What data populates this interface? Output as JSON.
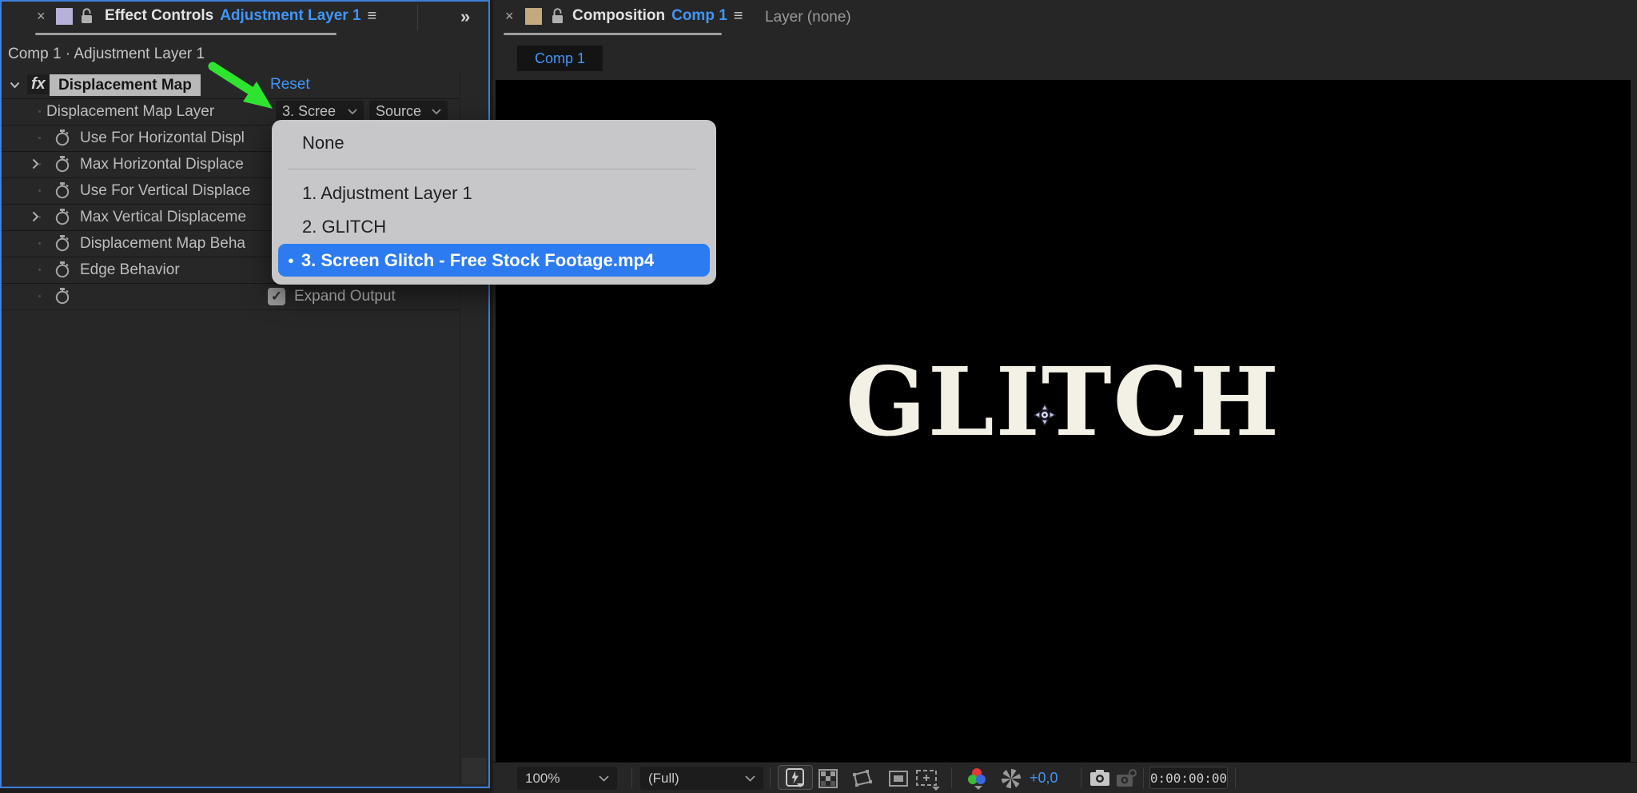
{
  "effect_panel": {
    "tab": {
      "close": "×",
      "title": "Effect Controls",
      "target": "Adjustment Layer 1",
      "menu_icon": "≡",
      "overflow_icon": "»"
    },
    "breadcrumb": "Comp 1 · Adjustment Layer 1",
    "effect_header": {
      "expand_icon": "∨",
      "fx_badge": "fx",
      "name": "Displacement Map",
      "reset": "Reset"
    },
    "rows": [
      {
        "label": "Displacement Map Layer",
        "value": "3. Scree",
        "channel": "Source"
      },
      {
        "label": "Use For Horizontal Displ"
      },
      {
        "label": "Max Horizontal Displace"
      },
      {
        "label": "Use For Vertical Displace"
      },
      {
        "label": "Max Vertical Displaceme"
      },
      {
        "label": "Displacement Map Beha"
      },
      {
        "label": "Edge Behavior"
      },
      {
        "label": "",
        "checkbox_label": "Expand Output",
        "checked": true
      }
    ]
  },
  "layer_menu": {
    "items": [
      "None",
      "1. Adjustment Layer 1",
      "2. GLITCH",
      "3. Screen Glitch - Free Stock Footage.mp4"
    ],
    "selected_index": 3,
    "bullet": "●"
  },
  "comp_panel": {
    "tab": {
      "close": "×",
      "title": "Composition",
      "target": "Comp 1",
      "menu_icon": "≡"
    },
    "layer_tab": "Layer (none)",
    "comp_tab": "Comp 1",
    "canvas_text": "GLITCH",
    "toolbar": {
      "zoom": "100%",
      "resolution": "(Full)",
      "exposure_offset": "+0,0",
      "timecode": "0:00:00:00"
    }
  },
  "icons": {
    "check": "✓"
  },
  "colors": {
    "accent_blue": "#4196f6",
    "selection_blue": "#2c7bf1",
    "arrow_green": "#2fe42f",
    "effect_swatch": "#b6b1d8",
    "comp_swatch": "#c2a97e",
    "canvas_text_color": "#f3f0e6"
  }
}
